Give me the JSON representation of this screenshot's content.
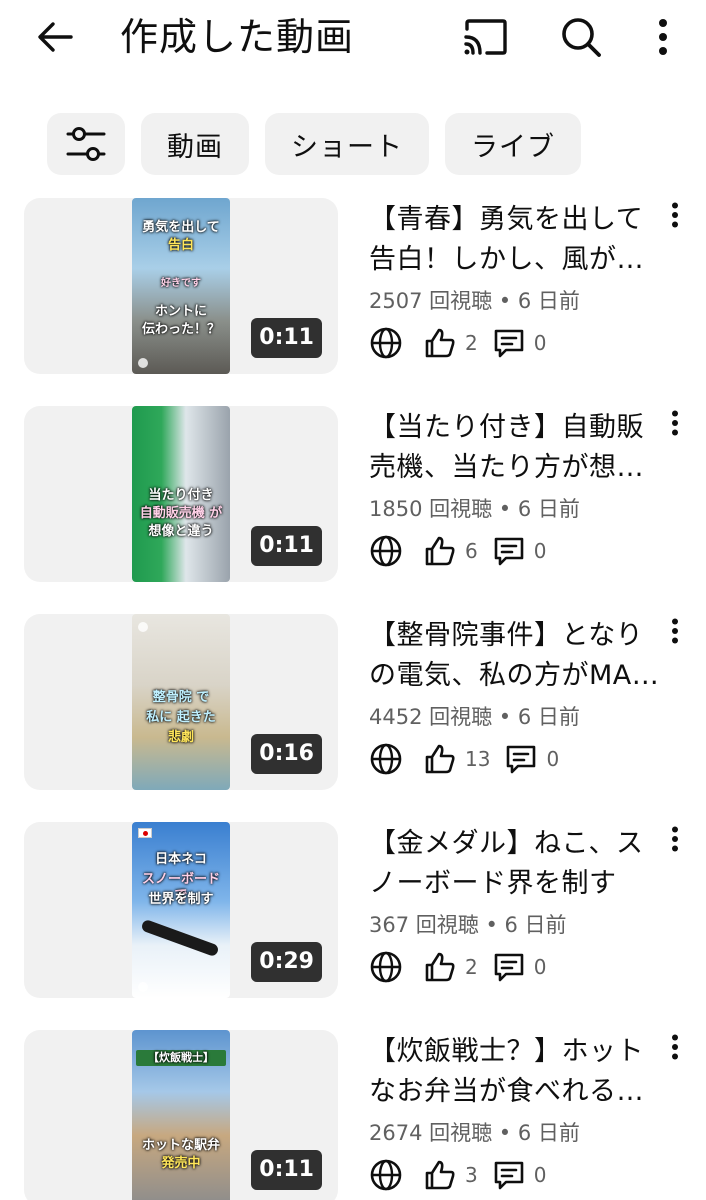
{
  "header": {
    "title": "作成した動画",
    "back_icon": "arrow-left-icon",
    "cast_icon": "cast-icon",
    "search_icon": "search-icon",
    "more_icon": "more-vertical-icon"
  },
  "chips": {
    "filter_icon": "sliders-icon",
    "items": [
      "動画",
      "ショート",
      "ライブ"
    ]
  },
  "videos": [
    {
      "title_line1": "【青春】勇気を出して",
      "title_line2": "告白！しかし、風が…",
      "views": "2507 回視聴",
      "age": "6 日前",
      "likes": "2",
      "comments": "0",
      "duration": "0:11",
      "thumb_text": [
        "勇気を出して",
        "告白",
        "好きです",
        "ホントに",
        "伝わった！？"
      ]
    },
    {
      "title_line1": "【当たり付き】自動販",
      "title_line2": "売機、当たり方が想…",
      "views": "1850 回視聴",
      "age": "6 日前",
      "likes": "6",
      "comments": "0",
      "duration": "0:11",
      "thumb_text": [
        "当たり付き",
        "自動販売機 が",
        "想像と違う"
      ]
    },
    {
      "title_line1": "【整骨院事件】となり",
      "title_line2": "の電気、私の方がMA…",
      "views": "4452 回視聴",
      "age": "6 日前",
      "likes": "13",
      "comments": "0",
      "duration": "0:16",
      "thumb_text": [
        "整骨院 で",
        "私に 起きた",
        "悲劇"
      ]
    },
    {
      "title_line1": "【金メダル】ねこ、ス",
      "title_line2": "ノーボード界を制す",
      "views": "367 回視聴",
      "age": "6 日前",
      "likes": "2",
      "comments": "0",
      "duration": "0:29",
      "thumb_text": [
        "日本ネコ",
        "スノーボード で",
        "世界を制す"
      ]
    },
    {
      "title_line1": "【炊飯戦士？】ホット",
      "title_line2": "なお弁当が食べれる…",
      "views": "2674 回視聴",
      "age": "6 日前",
      "likes": "3",
      "comments": "0",
      "duration": "0:11",
      "thumb_text": [
        "【炊飯戦士】",
        "ホットな駅弁",
        "発売中"
      ]
    }
  ],
  "colors": {
    "text": "#0f0f0f",
    "secondary": "#606060",
    "chip_bg": "#f1f1f1"
  }
}
